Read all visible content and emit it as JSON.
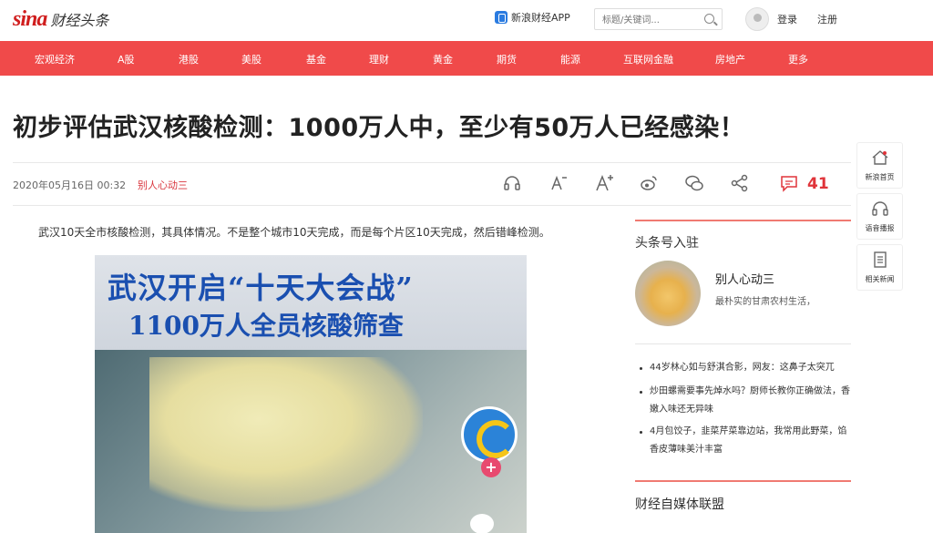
{
  "header": {
    "logo_text": "sina",
    "logo_subtitle": "财经头条",
    "app_link": "新浪财经APP",
    "search_placeholder": "标题/关键词...",
    "login": "登录",
    "register": "注册"
  },
  "nav": {
    "items": [
      "宏观经济",
      "A股",
      "港股",
      "美股",
      "基金",
      "理财",
      "黄金",
      "期货",
      "能源",
      "互联网金融",
      "房地产",
      "更多"
    ]
  },
  "article": {
    "title": "初步评估武汉核酸检测：1000万人中，至少有50万人已经感染！",
    "date": "2020年05月16日 00:32",
    "source": "别人心动三",
    "comment_count": "41",
    "lead": "武汉10天全市核酸检测，其具体情况。不是整个城市10天完成，而是每个片区10天完成，然后错峰检测。",
    "image": {
      "line1": "武汉开启“十天大会战”",
      "line2": "1100万人全员核酸筛查"
    },
    "tools": [
      "audio-icon",
      "font-decrease-icon",
      "font-increase-icon",
      "weibo-icon",
      "wechat-icon",
      "share-icon",
      "comment-icon"
    ]
  },
  "sidebar": {
    "section1_title": "头条号入驻",
    "author_name": "别人心动三",
    "author_desc": "最朴实的甘肃农村生活，",
    "news": [
      "44岁林心如与舒淇合影，网友：这鼻子太突兀",
      "炒田螺需要事先焯水吗？厨师长教你正确做法，香嫩入味还无异味",
      "4月包饺子，韭菜芹菜靠边站，我常用此野菜，馅香皮薄味美汁丰富"
    ],
    "section2_title": "财经自媒体联盟"
  },
  "float": {
    "home": "新浪首页",
    "audio": "语音播报",
    "related": "相关新闻"
  },
  "colors": {
    "nav_bg": "#f04a4a",
    "accent": "#e0343a"
  }
}
